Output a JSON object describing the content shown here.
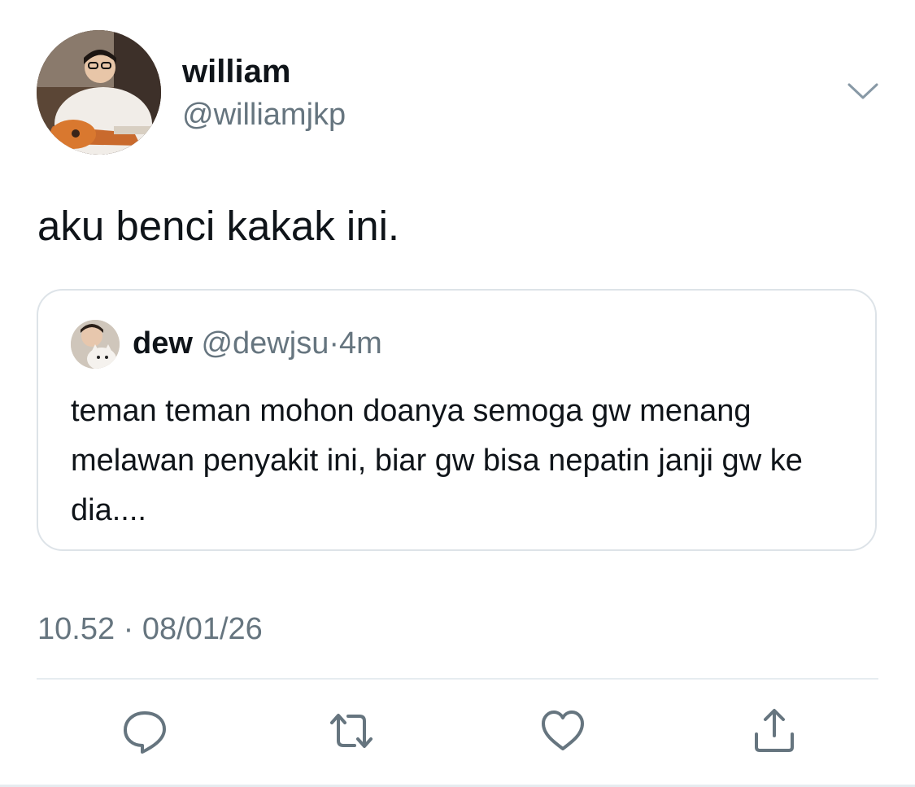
{
  "author": {
    "display_name": "william",
    "handle": "@williamjkp"
  },
  "tweet": {
    "text": "aku benci kakak ini.",
    "timestamp": "10.52 · 08/01/26"
  },
  "quoted_tweet": {
    "display_name": "dew",
    "handle": "@dewjsu",
    "separator": "·",
    "time": "4m",
    "text": "teman teman mohon doanya semoga gw menang melawan penyakit ini, biar gw bisa nepatin janji gw ke dia...."
  },
  "actions": [
    {
      "icon": "reply-icon"
    },
    {
      "icon": "retweet-icon"
    },
    {
      "icon": "like-icon"
    },
    {
      "icon": "share-icon"
    }
  ],
  "colors": {
    "text_primary": "#0f1419",
    "text_secondary": "#66757f",
    "border": "#dde3e8",
    "icon": "#66757f"
  }
}
